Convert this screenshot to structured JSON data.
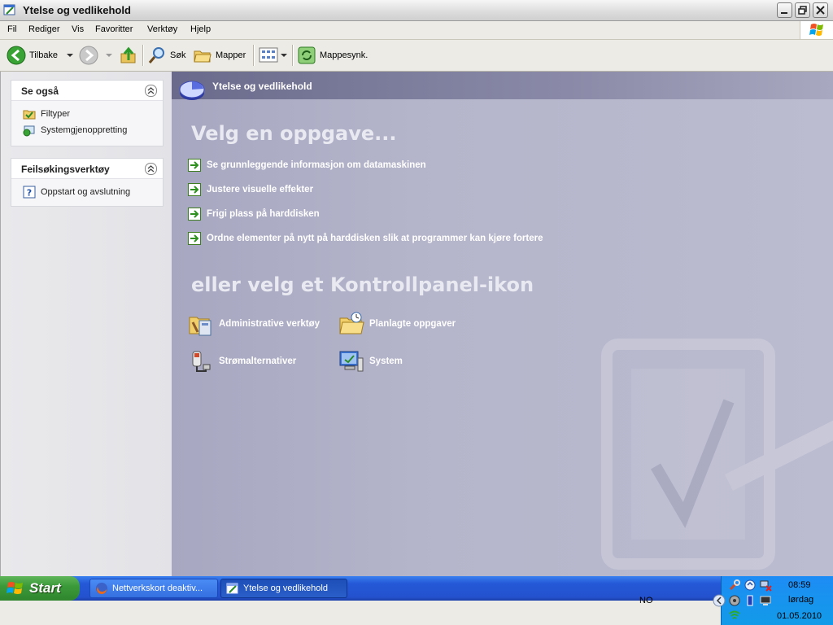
{
  "window": {
    "title": "Ytelse og vedlikehold"
  },
  "menu": [
    "Fil",
    "Rediger",
    "Vis",
    "Favoritter",
    "Verktøy",
    "Hjelp"
  ],
  "toolbar": {
    "back_label": "Tilbake",
    "search_label": "Søk",
    "folders_label": "Mapper",
    "sync_label": "Mappesynk."
  },
  "sidebar": {
    "see_also": {
      "title": "Se også",
      "items": [
        "Filtyper",
        "Systemgjenoppretting"
      ]
    },
    "troubleshoot": {
      "title": "Feilsøkingsverktøy",
      "items": [
        "Oppstart og avslutning"
      ]
    }
  },
  "main": {
    "header_title": "Ytelse og vedlikehold",
    "pick_task_heading": "Velg en oppgave...",
    "tasks": [
      "Se grunnleggende informasjon om datamaskinen",
      "Justere visuelle effekter",
      "Frigi plass på harddisken",
      "Ordne elementer på nytt på harddisken slik at programmer kan kjøre fortere"
    ],
    "or_pick_heading": "eller velg et Kontrollpanel-ikon",
    "icons": [
      "Administrative verktøy",
      "Planlagte oppgaver",
      "Strømalternativer",
      "System"
    ]
  },
  "taskbar": {
    "start_label": "Start",
    "buttons": [
      "Nettverkskort deaktiv...",
      "Ytelse og vedlikehold"
    ],
    "language": "NO",
    "clock": {
      "time": "08:59",
      "day": "lørdag",
      "date": "01.05.2010"
    }
  },
  "colors": {
    "main_bg": "#b5b5cb",
    "header_bg": "#6a6a8c",
    "taskbar_bg": "#2452cf",
    "start_green": "#3c9a3a"
  }
}
